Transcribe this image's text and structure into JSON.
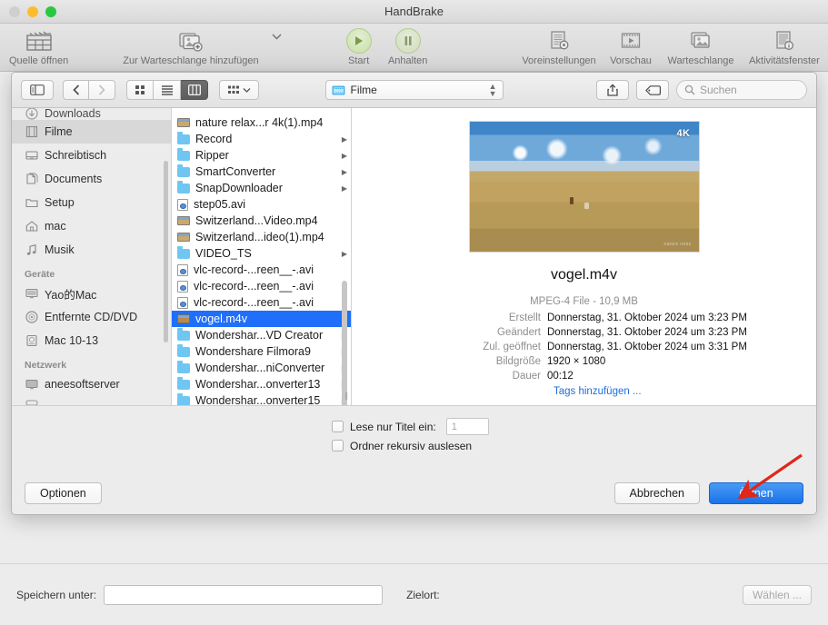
{
  "window": {
    "title": "HandBrake",
    "traffic_lights": [
      "close-grey",
      "minimize-yellow",
      "zoom-green"
    ]
  },
  "toolbar": {
    "left": [
      {
        "label": "Quelle öffnen",
        "icon": "clapperboard-icon"
      },
      {
        "label": "Zur Warteschlange hinzufügen",
        "icon": "add-to-queue-icon"
      }
    ],
    "center": [
      {
        "label": "Start",
        "icon": "play-icon"
      },
      {
        "label": "Anhalten",
        "icon": "pause-icon"
      }
    ],
    "right": [
      {
        "label": "Voreinstellungen",
        "icon": "presets-icon"
      },
      {
        "label": "Vorschau",
        "icon": "preview-film-icon"
      },
      {
        "label": "Warteschlange",
        "icon": "queue-stack-icon"
      },
      {
        "label": "Aktivitätsfenster",
        "icon": "activity-log-icon"
      }
    ]
  },
  "dialog": {
    "toolbar": {
      "sidebar_toggle_icon": "sidebar-toggle-icon",
      "back_icon": "chevron-left-icon",
      "forward_icon": "chevron-right-icon",
      "view_icons": [
        "icon-view-icon",
        "list-view-icon",
        "column-view-icon"
      ],
      "view_active_index": 2,
      "arrange_icon": "arrange-grid-icon",
      "share_icon": "share-icon",
      "tag_icon": "tag-icon",
      "path_label": "Filme",
      "path_icon": "folder-movies-icon",
      "search_placeholder": "Suchen",
      "search_icon": "search-icon"
    },
    "sidebar": {
      "partial_top_item": "Downloads",
      "favorites": [
        {
          "label": "Filme",
          "icon": "movies-icon",
          "selected": true
        },
        {
          "label": "Schreibtisch",
          "icon": "desktop-icon",
          "selected": false
        },
        {
          "label": "Documents",
          "icon": "documents-icon",
          "selected": false
        },
        {
          "label": "Setup",
          "icon": "folder-icon",
          "selected": false
        },
        {
          "label": "mac",
          "icon": "home-icon",
          "selected": false
        },
        {
          "label": "Musik",
          "icon": "music-note-icon",
          "selected": false
        }
      ],
      "devices_header": "Geräte",
      "devices": [
        {
          "label": "Yao的Mac",
          "icon": "imac-icon"
        },
        {
          "label": "Entfernte CD/DVD",
          "icon": "disc-icon"
        },
        {
          "label": "Mac 10-13",
          "icon": "harddisk-icon"
        }
      ],
      "network_header": "Netzwerk",
      "network": [
        {
          "label": "aneesoftserver",
          "icon": "server-display-icon"
        }
      ]
    },
    "file_list": [
      {
        "name": "nature relax...r 4k(1).mp4",
        "type": "movie",
        "has_arrow": false,
        "selected": false
      },
      {
        "name": "Record",
        "type": "folder",
        "has_arrow": true,
        "selected": false
      },
      {
        "name": "Ripper",
        "type": "folder",
        "has_arrow": true,
        "selected": false
      },
      {
        "name": "SmartConverter",
        "type": "folder",
        "has_arrow": true,
        "selected": false
      },
      {
        "name": "SnapDownloader",
        "type": "folder",
        "has_arrow": true,
        "selected": false
      },
      {
        "name": "step05.avi",
        "type": "doc",
        "has_arrow": false,
        "selected": false
      },
      {
        "name": "Switzerland...Video.mp4",
        "type": "movie",
        "has_arrow": false,
        "selected": false
      },
      {
        "name": "Switzerland...ideo(1).mp4",
        "type": "movie",
        "has_arrow": false,
        "selected": false
      },
      {
        "name": "VIDEO_TS",
        "type": "folder",
        "has_arrow": true,
        "selected": false
      },
      {
        "name": "vlc-record-...reen__-.avi",
        "type": "doc",
        "has_arrow": false,
        "selected": false
      },
      {
        "name": "vlc-record-...reen__-.avi",
        "type": "doc",
        "has_arrow": false,
        "selected": false
      },
      {
        "name": "vlc-record-...reen__-.avi",
        "type": "doc",
        "has_arrow": false,
        "selected": false
      },
      {
        "name": "vogel.m4v",
        "type": "m4v",
        "has_arrow": false,
        "selected": true
      },
      {
        "name": "Wondershar...VD Creator",
        "type": "folder",
        "has_arrow": true,
        "selected": false
      },
      {
        "name": "Wondershare Filmora9",
        "type": "folder",
        "has_arrow": true,
        "selected": false
      },
      {
        "name": "Wondershar...niConverter",
        "type": "folder",
        "has_arrow": true,
        "selected": false
      },
      {
        "name": "Wondershar...onverter13",
        "type": "folder",
        "has_arrow": true,
        "selected": false
      },
      {
        "name": "Wondershar...onverter15",
        "type": "folder",
        "has_arrow": true,
        "selected": false
      }
    ],
    "preview": {
      "thumbnail": {
        "badge": "4K",
        "watermark": "nature relax",
        "description": "savanna grassland under blue sky with two animals"
      },
      "file_name": "vogel.m4v",
      "subtitle": "MPEG-4 File - 10,9 MB",
      "rows": [
        {
          "key": "Erstellt",
          "value": "Donnerstag, 31. Oktober 2024 um 3:23 PM"
        },
        {
          "key": "Geändert",
          "value": "Donnerstag, 31. Oktober 2024 um 3:23 PM"
        },
        {
          "key": "Zul. geöffnet",
          "value": "Donnerstag, 31. Oktober 2024 um 3:31 PM"
        },
        {
          "key": "Bildgröße",
          "value": "1920 × 1080"
        },
        {
          "key": "Dauer",
          "value": "00:12"
        }
      ],
      "tags_link": "Tags hinzufügen ..."
    },
    "options": {
      "title_only_label": "Lese nur Titel ein:",
      "title_only_value": "1",
      "title_only_checked": false,
      "recursive_label": "Ordner rekursiv auslesen",
      "recursive_checked": false
    },
    "actions": {
      "options_button": "Optionen",
      "cancel_button": "Abbrechen",
      "open_button": "Öffnen"
    }
  },
  "bottom_bar": {
    "save_as_label": "Speichern unter:",
    "save_as_value": "",
    "destination_label": "Zielort:",
    "choose_button": "Wählen ..."
  },
  "annotation": {
    "arrow": "red-arrow-pointing-to-open-button",
    "color": "#e02718"
  }
}
